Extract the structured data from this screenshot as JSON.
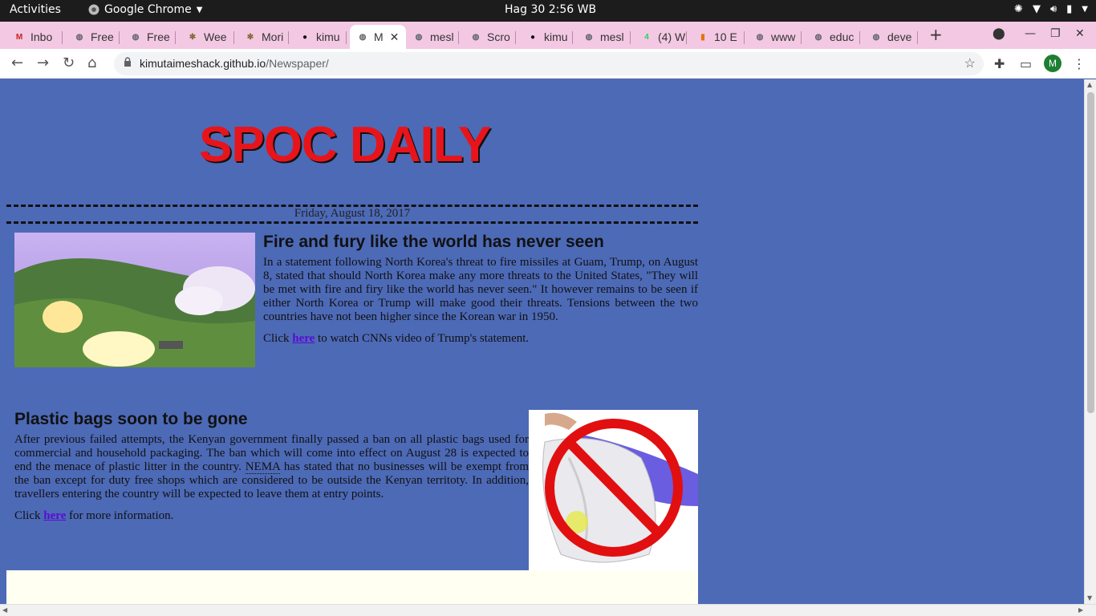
{
  "system_bar": {
    "activities": "Activities",
    "app_name": "Google Chrome",
    "clock": "Hag 30  2:56 WB"
  },
  "tabs": [
    {
      "label": "Inbo",
      "icon": "gmail-icon",
      "color": "#c5221f"
    },
    {
      "label": "Free",
      "icon": "globe-icon",
      "color": "#5f6368"
    },
    {
      "label": "Free",
      "icon": "globe-icon",
      "color": "#5f6368"
    },
    {
      "label": "Wee",
      "icon": "palm-icon",
      "color": "#8a6d3b"
    },
    {
      "label": "Mori",
      "icon": "palm-icon",
      "color": "#8a6d3b"
    },
    {
      "label": "kimu",
      "icon": "github-icon",
      "color": "#111111"
    },
    {
      "label": "M",
      "icon": "globe-icon",
      "color": "#5f6368",
      "active": true
    },
    {
      "label": "mesl",
      "icon": "globe-icon",
      "color": "#5f6368"
    },
    {
      "label": "Scro",
      "icon": "globe-icon",
      "color": "#5f6368"
    },
    {
      "label": "kimu",
      "icon": "github-icon",
      "color": "#111111"
    },
    {
      "label": "mesl",
      "icon": "globe-icon",
      "color": "#5f6368"
    },
    {
      "label": "(4) W",
      "icon": "whatsapp-icon",
      "color": "#25d366"
    },
    {
      "label": "10 E",
      "icon": "bars-icon",
      "color": "#e37400"
    },
    {
      "label": "www",
      "icon": "globe-icon",
      "color": "#5f6368"
    },
    {
      "label": "educ",
      "icon": "globe-icon",
      "color": "#5f6368"
    },
    {
      "label": "deve",
      "icon": "globe-icon",
      "color": "#5f6368"
    }
  ],
  "address_bar": {
    "host": "kimutaimeshack.github.io",
    "path": "/Newspaper/"
  },
  "profile_initial": "M",
  "page": {
    "masthead": "SPOC DAILY",
    "date": "Friday, August 18, 2017",
    "article1": {
      "title": "Fire and fury like the world has never seen",
      "body": "In a statement following North Korea's threat to fire missiles at Guam, Trump, on August 8, stated that should North Korea make any more threats to the United States, \"They will be met with fire and firy like the world has never seen.\" It however remains to be seen if either North Korea or Trump will make good their threats. Tensions between the two countries have not been higher since the Korean war in 1950.",
      "click_prefix": "Click",
      "link_text": "here",
      "click_suffix": "to watch CNNs video of Trump's statement."
    },
    "article2": {
      "title": "Plastic bags soon to be gone",
      "body_before_abbr": "After previous failed attempts, the Kenyan government finally passed a ban on all plastic bags used for commercial and household packaging. The ban which will come into effect on August 28 is expected to end the menace of plastic litter in the country.",
      "abbr": "NEMA",
      "body_after_abbr": "has stated that no businesses will be exempt from the ban except for duty free shops which are considered to be outside the Kenyan territoty. In addition, travellers entering the country will be expected to leave them at entry points.",
      "click_prefix": "Click",
      "link_text": "here",
      "click_suffix": "for more information."
    }
  },
  "colors": {
    "page_background": "#4d6ab7",
    "masthead": "#e8141b",
    "tab_strip": "#f3c8e3",
    "link": "#5a0bd3"
  }
}
